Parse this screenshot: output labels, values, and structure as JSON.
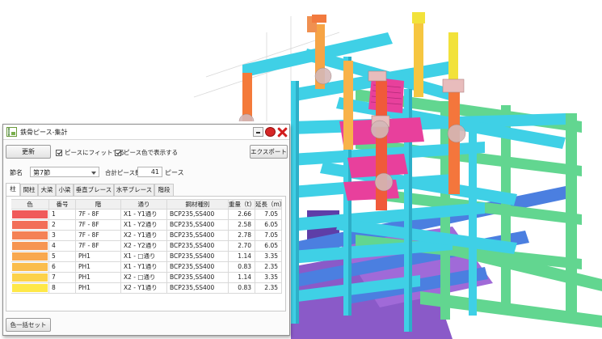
{
  "window": {
    "title": "鉄骨ピース-集計"
  },
  "toolbar": {
    "update": "更新",
    "export": "エクスポート",
    "fit_label": "ピースにフィットする",
    "color_label": "ピース色で表示する"
  },
  "filter": {
    "label": "節名",
    "value": "第7節",
    "total_label": "合計ピース数",
    "total_value": "41",
    "total_unit": "ピース"
  },
  "tabs": [
    "柱",
    "間柱",
    "大梁",
    "小梁",
    "垂直ブレース",
    "水平ブレース",
    "階段"
  ],
  "table": {
    "headers": [
      "色",
      "番号",
      "階",
      "通り",
      "鋼材種別",
      "重量（t）",
      "延長（m）"
    ],
    "rows": [
      {
        "color": "#f05a5a",
        "no": "1",
        "floor": "7F - 8F",
        "line": "X1 - Y1通り",
        "steel": "BCP235,SS400",
        "weight": "2.66",
        "length": "7.05"
      },
      {
        "color": "#f26e58",
        "no": "2",
        "floor": "7F - 8F",
        "line": "X1 - Y2通り",
        "steel": "BCP235,SS400",
        "weight": "2.58",
        "length": "6.05"
      },
      {
        "color": "#f48155",
        "no": "3",
        "floor": "7F - 8F",
        "line": "X2 - Y1通り",
        "steel": "BCP235,SS400",
        "weight": "2.78",
        "length": "7.05"
      },
      {
        "color": "#f69552",
        "no": "4",
        "floor": "7F - 8F",
        "line": "X2 - Y2通り",
        "steel": "BCP235,SS400",
        "weight": "2.70",
        "length": "6.05"
      },
      {
        "color": "#f8a84f",
        "no": "5",
        "floor": "PH1",
        "line": "X1 - □通り",
        "steel": "BCP235,SS400",
        "weight": "1.14",
        "length": "3.35"
      },
      {
        "color": "#fabd4c",
        "no": "6",
        "floor": "PH1",
        "line": "X1 - Y1通り",
        "steel": "BCP235,SS400",
        "weight": "0.83",
        "length": "2.35"
      },
      {
        "color": "#fcd24a",
        "no": "7",
        "floor": "PH1",
        "line": "X2 - □通り",
        "steel": "BCP235,SS400",
        "weight": "1.14",
        "length": "3.35"
      },
      {
        "color": "#fee848",
        "no": "8",
        "floor": "PH1",
        "line": "X2 - Y1通り",
        "steel": "BCP235,SS400",
        "weight": "0.83",
        "length": "2.35"
      }
    ]
  },
  "footer": {
    "color_batch": "色一括セット"
  },
  "colors": {
    "beam_cyan": "#3fd0e6",
    "beam_green": "#62d690",
    "column_orange": "#f47a3a",
    "column_yellow": "#f2e23a",
    "stair_magenta": "#e8409c",
    "bg_purple": "#8a5ac8"
  }
}
